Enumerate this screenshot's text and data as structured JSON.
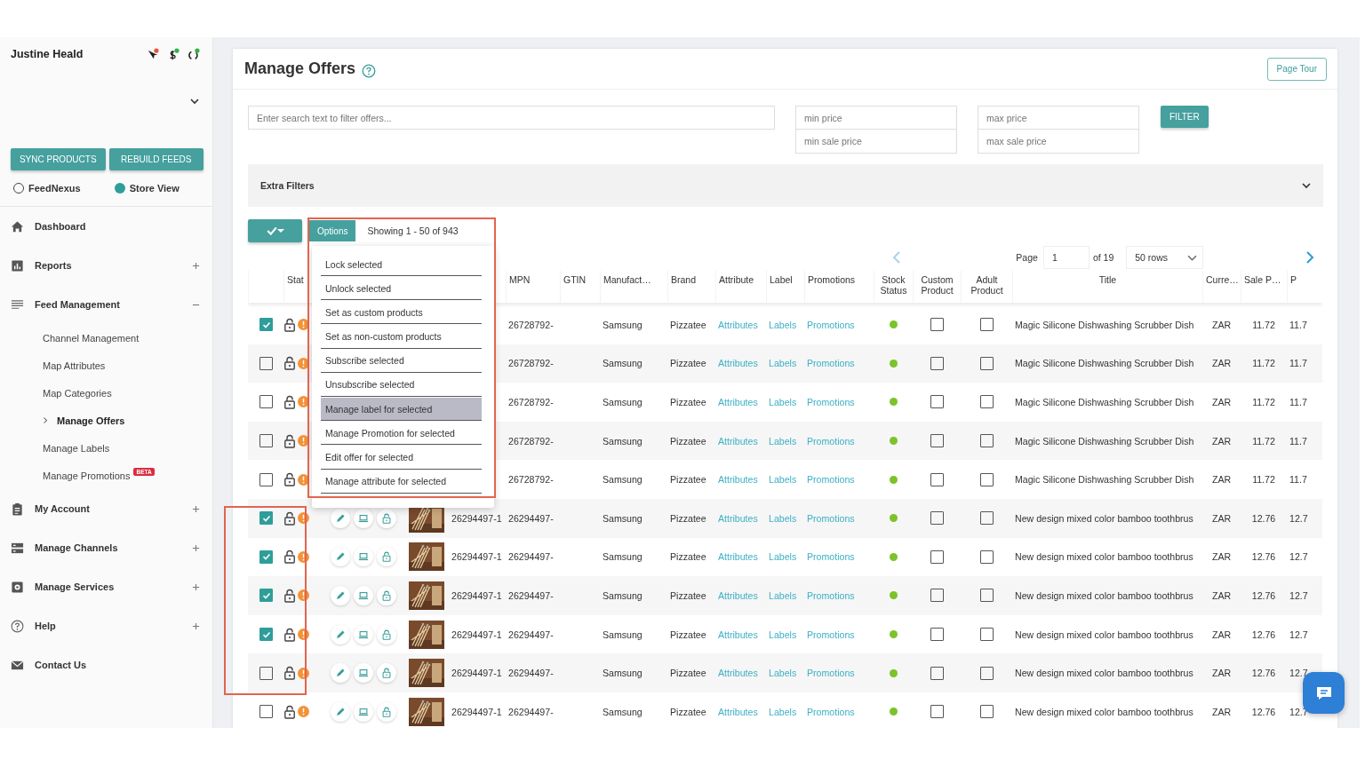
{
  "sidebar": {
    "user_name": "Justine Heald",
    "status_icons": [
      {
        "kind": "cursor",
        "color": "#e8553e"
      },
      {
        "kind": "dollar",
        "color": "#2fb344"
      },
      {
        "kind": "sync",
        "color": "#2fb344"
      }
    ],
    "buttons": [
      "SYNC PRODUCTS",
      "REBUILD FEEDS"
    ],
    "views": [
      {
        "label": "FeedNexus",
        "selected": false
      },
      {
        "label": "Store View",
        "selected": true
      }
    ],
    "nav": [
      {
        "label": "Dashboard",
        "kind": "home"
      },
      {
        "label": "Reports",
        "kind": "chart",
        "expanded": false
      },
      {
        "label": "Feed Management",
        "kind": "lines",
        "expanded": true,
        "children": [
          {
            "label": "Channel Management",
            "selected": false
          },
          {
            "label": "Map Attributes",
            "selected": false
          },
          {
            "label": "Map Categories",
            "selected": false
          },
          {
            "label": "Manage Offers",
            "selected": true
          },
          {
            "label": "Manage Labels",
            "selected": false
          },
          {
            "label": "Manage Promotions",
            "selected": false,
            "badge": "BETA"
          }
        ]
      },
      {
        "label": "My Account",
        "kind": "clipboard",
        "expanded": false
      },
      {
        "label": "Manage Channels",
        "kind": "server",
        "expanded": false
      },
      {
        "label": "Manage Services",
        "kind": "gear",
        "expanded": false
      },
      {
        "label": "Help",
        "kind": "help",
        "expanded": false
      },
      {
        "label": "Contact Us",
        "kind": "mail"
      }
    ]
  },
  "main": {
    "title": "Manage Offers",
    "page_tour": "Page Tour",
    "search": {
      "placeholder": "Enter search text to filter offers..."
    },
    "price_filters": [
      {
        "placeholders": [
          "min price",
          "min sale price"
        ]
      },
      {
        "placeholders": [
          "max price",
          "max sale price"
        ]
      }
    ],
    "filter_button": "FILTER",
    "extra_filters": {
      "label": "Extra Filters",
      "expanded": false
    },
    "toolbar": {
      "options": "Options",
      "showing": "Showing 1 - 50 of 943"
    },
    "options_menu": {
      "open": true,
      "items": [
        {
          "label": "Lock selected",
          "selected": false
        },
        {
          "label": "Unlock selected",
          "selected": false
        },
        {
          "label": "Set as custom products",
          "selected": false
        },
        {
          "label": "Set as non-custom products",
          "selected": false
        },
        {
          "label": "Subscribe selected",
          "selected": false
        },
        {
          "label": "Unsubscribe selected",
          "selected": false
        },
        {
          "label": "Manage label for selected",
          "selected": true
        },
        {
          "label": "Manage Promotion for selected",
          "selected": false
        },
        {
          "label": "Edit offer for selected",
          "selected": false
        },
        {
          "label": "Manage attribute for selected",
          "selected": false
        }
      ]
    },
    "pagination": {
      "page_label": "Page",
      "page": "1",
      "of": "of 19",
      "rows": "50 rows"
    },
    "table": {
      "columns": [
        "Stat",
        "MPN",
        "GTIN",
        "Manufact…",
        "Brand",
        "Attribute",
        "Label",
        "Promotions",
        "Stock Status",
        "Custom Product",
        "Adult Product",
        "Title",
        "Curre…",
        "Sale P…",
        "P"
      ],
      "rows": [
        {
          "checked": true,
          "warning": true,
          "mpn": "26728792-",
          "manufacturer": "Samsung",
          "brand": "Pizzatee",
          "attribute": "Attributes",
          "label": "Labels",
          "promotions": "Promotions",
          "in_stock": true,
          "custom": false,
          "adult": false,
          "title": "Magic Silicone Dishwashing Scrubber Dish",
          "currency": "ZAR",
          "sale_price": "11.72",
          "price": "11.7"
        },
        {
          "checked": false,
          "warning": true,
          "mpn": "26728792-",
          "manufacturer": "Samsung",
          "brand": "Pizzatee",
          "attribute": "Attributes",
          "label": "Labels",
          "promotions": "Promotions",
          "in_stock": true,
          "custom": false,
          "adult": false,
          "title": "Magic Silicone Dishwashing Scrubber Dish",
          "currency": "ZAR",
          "sale_price": "11.72",
          "price": "11.7"
        },
        {
          "checked": false,
          "warning": true,
          "mpn": "26728792-",
          "manufacturer": "Samsung",
          "brand": "Pizzatee",
          "attribute": "Attributes",
          "label": "Labels",
          "promotions": "Promotions",
          "in_stock": true,
          "custom": false,
          "adult": false,
          "title": "Magic Silicone Dishwashing Scrubber Dish",
          "currency": "ZAR",
          "sale_price": "11.72",
          "price": "11.7"
        },
        {
          "checked": false,
          "warning": true,
          "mpn": "26728792-",
          "manufacturer": "Samsung",
          "brand": "Pizzatee",
          "attribute": "Attributes",
          "label": "Labels",
          "promotions": "Promotions",
          "in_stock": true,
          "custom": false,
          "adult": false,
          "title": "Magic Silicone Dishwashing Scrubber Dish",
          "currency": "ZAR",
          "sale_price": "11.72",
          "price": "11.7"
        },
        {
          "checked": false,
          "warning": true,
          "mpn": "26728792-",
          "manufacturer": "Samsung",
          "brand": "Pizzatee",
          "attribute": "Attributes",
          "label": "Labels",
          "promotions": "Promotions",
          "in_stock": true,
          "custom": false,
          "adult": false,
          "title": "Magic Silicone Dishwashing Scrubber Dish",
          "currency": "ZAR",
          "sale_price": "11.72",
          "price": "11.7"
        },
        {
          "checked": true,
          "warning": true,
          "sku": "26294497-1",
          "mpn": "26294497-",
          "manufacturer": "Samsung",
          "brand": "Pizzatee",
          "attribute": "Attributes",
          "label": "Labels",
          "promotions": "Promotions",
          "in_stock": true,
          "custom": false,
          "adult": false,
          "title": "New design mixed color bamboo toothbrus",
          "currency": "ZAR",
          "sale_price": "12.76",
          "price": "12.7"
        },
        {
          "checked": true,
          "warning": true,
          "sku": "26294497-1",
          "mpn": "26294497-",
          "manufacturer": "Samsung",
          "brand": "Pizzatee",
          "attribute": "Attributes",
          "label": "Labels",
          "promotions": "Promotions",
          "in_stock": true,
          "custom": false,
          "adult": false,
          "title": "New design mixed color bamboo toothbrus",
          "currency": "ZAR",
          "sale_price": "12.76",
          "price": "12.7"
        },
        {
          "checked": true,
          "warning": true,
          "sku": "26294497-1",
          "mpn": "26294497-",
          "manufacturer": "Samsung",
          "brand": "Pizzatee",
          "attribute": "Attributes",
          "label": "Labels",
          "promotions": "Promotions",
          "in_stock": true,
          "custom": false,
          "adult": false,
          "title": "New design mixed color bamboo toothbrus",
          "currency": "ZAR",
          "sale_price": "12.76",
          "price": "12.7"
        },
        {
          "checked": true,
          "warning": true,
          "sku": "26294497-1",
          "mpn": "26294497-",
          "manufacturer": "Samsung",
          "brand": "Pizzatee",
          "attribute": "Attributes",
          "label": "Labels",
          "promotions": "Promotions",
          "in_stock": true,
          "custom": false,
          "adult": false,
          "title": "New design mixed color bamboo toothbrus",
          "currency": "ZAR",
          "sale_price": "12.76",
          "price": "12.7"
        },
        {
          "checked": false,
          "warning": true,
          "sku": "26294497-1",
          "mpn": "26294497-",
          "manufacturer": "Samsung",
          "brand": "Pizzatee",
          "attribute": "Attributes",
          "label": "Labels",
          "promotions": "Promotions",
          "in_stock": true,
          "custom": false,
          "adult": false,
          "title": "New design mixed color bamboo toothbrus",
          "currency": "ZAR",
          "sale_price": "12.76",
          "price": "12.7"
        },
        {
          "checked": false,
          "warning": true,
          "sku": "26294497-1",
          "mpn": "26294497-",
          "manufacturer": "Samsung",
          "brand": "Pizzatee",
          "attribute": "Attributes",
          "label": "Labels",
          "promotions": "Promotions",
          "in_stock": true,
          "custom": false,
          "adult": false,
          "title": "New design mixed color bamboo toothbrus",
          "currency": "ZAR",
          "sale_price": "12.76",
          "price": "12.7"
        }
      ]
    }
  }
}
